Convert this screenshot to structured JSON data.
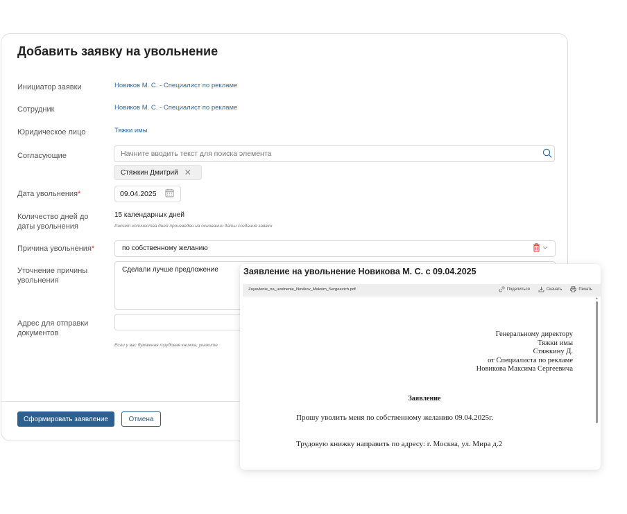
{
  "form": {
    "title": "Добавить заявку на увольнение",
    "fields": {
      "initiator": {
        "label": "Инициатор заявки",
        "value": "Новиков М. С. - Специалист по рекламе"
      },
      "employee": {
        "label": "Сотрудник",
        "value": "Новиков М. С. - Специалист по рекламе"
      },
      "legal_entity": {
        "label": "Юридическое лицо",
        "value": "Тяжки имы"
      },
      "approvers": {
        "label": "Согласующие",
        "placeholder": "Начните вводить текст для поиска элемента",
        "tags": [
          "Стяжкин Дмитрий"
        ]
      },
      "dismissal_date": {
        "label": "Дата увольнения",
        "required_mark": "*",
        "value": "09.04.2025"
      },
      "days_count": {
        "label_line1": "Количество дней до",
        "label_line2": "даты увольнения",
        "value": "15 календарных дней",
        "hint": "Расчет количества дней произведен на основании даты создания заявки"
      },
      "reason": {
        "label": "Причина увольнения",
        "required_mark": "*",
        "value": "по собственному желанию"
      },
      "reason_details": {
        "label_line1": "Уточнение причины",
        "label_line2": "увольнения",
        "value": "Сделали лучше предложение"
      },
      "address": {
        "label_line1": "Адрес для отправки",
        "label_line2": "документов",
        "hint": "Если у вас бумажная трудовая книжка, укажите"
      }
    },
    "buttons": {
      "submit": "Сформировать заявление",
      "cancel": "Отмена"
    }
  },
  "document": {
    "title": "Заявление на увольнение Новикова М. С. с 09.04.2025",
    "filename": "Zayavlenie_na_uvolnenie_Novikov_Maksim_Sergeevich.pdf",
    "actions": {
      "share": "Поделиться",
      "download": "Скачать",
      "print": "Печать"
    },
    "addressee": [
      "Генеральному директору",
      "Тяжки имы",
      "Стяжкину Д.",
      "от Специалиста по рекламе",
      "Новикова Максима Сергеевича"
    ],
    "heading": "Заявление",
    "line1": "Прошу уволить меня по собственному желанию 09.04.2025г.",
    "line2": "Трудовую книжку направить по адресу: г. Москва, ул. Мира д.2"
  },
  "colors": {
    "accent": "#2d5f8f",
    "link": "#2a6aa6",
    "required": "#e0302c",
    "trash": "#e0302c"
  }
}
